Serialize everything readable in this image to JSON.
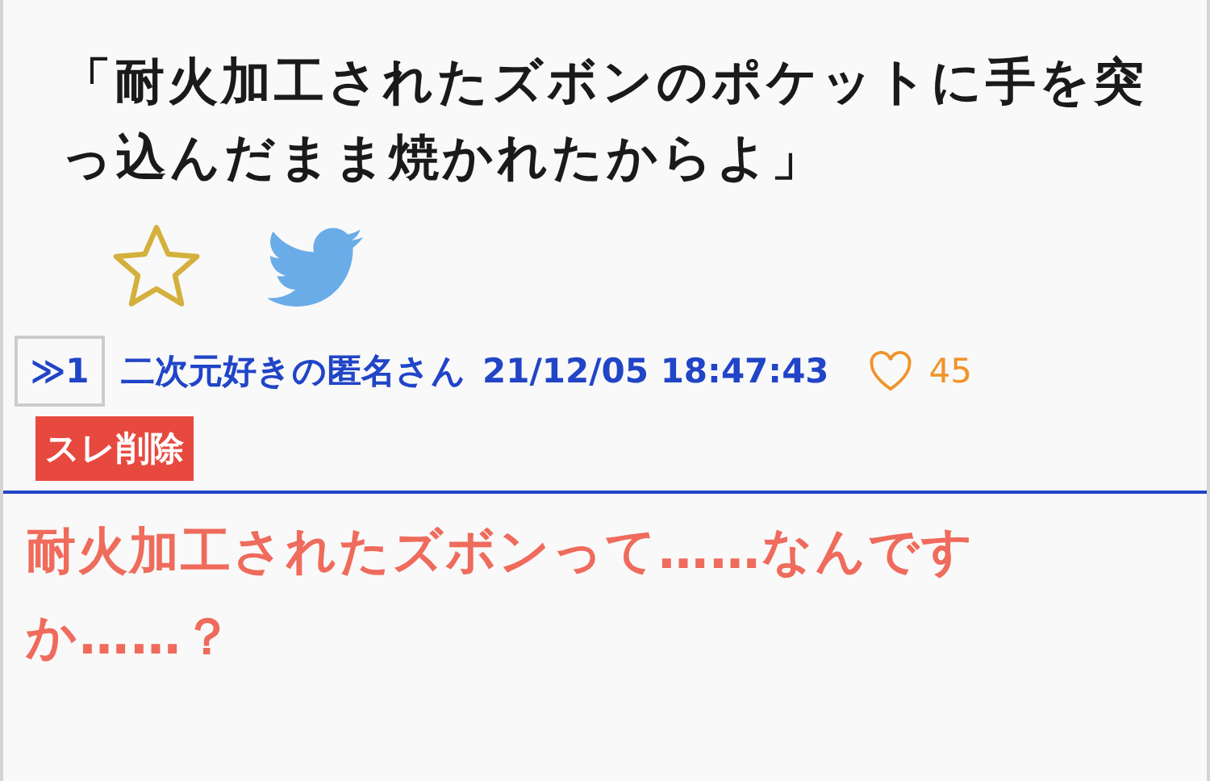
{
  "post": {
    "title": "「耐火加工されたズボンのポケットに手を突っ込んだまま焼かれたからよ」",
    "favorited": false
  },
  "reply": {
    "anchor": "≫1",
    "author": "二次元好きの匿名さん",
    "timestamp": "21/12/05 18:47:43",
    "likes": "45",
    "delete_button": "スレ削除",
    "body": "耐火加工されたズボンって……なんですか……？"
  }
}
